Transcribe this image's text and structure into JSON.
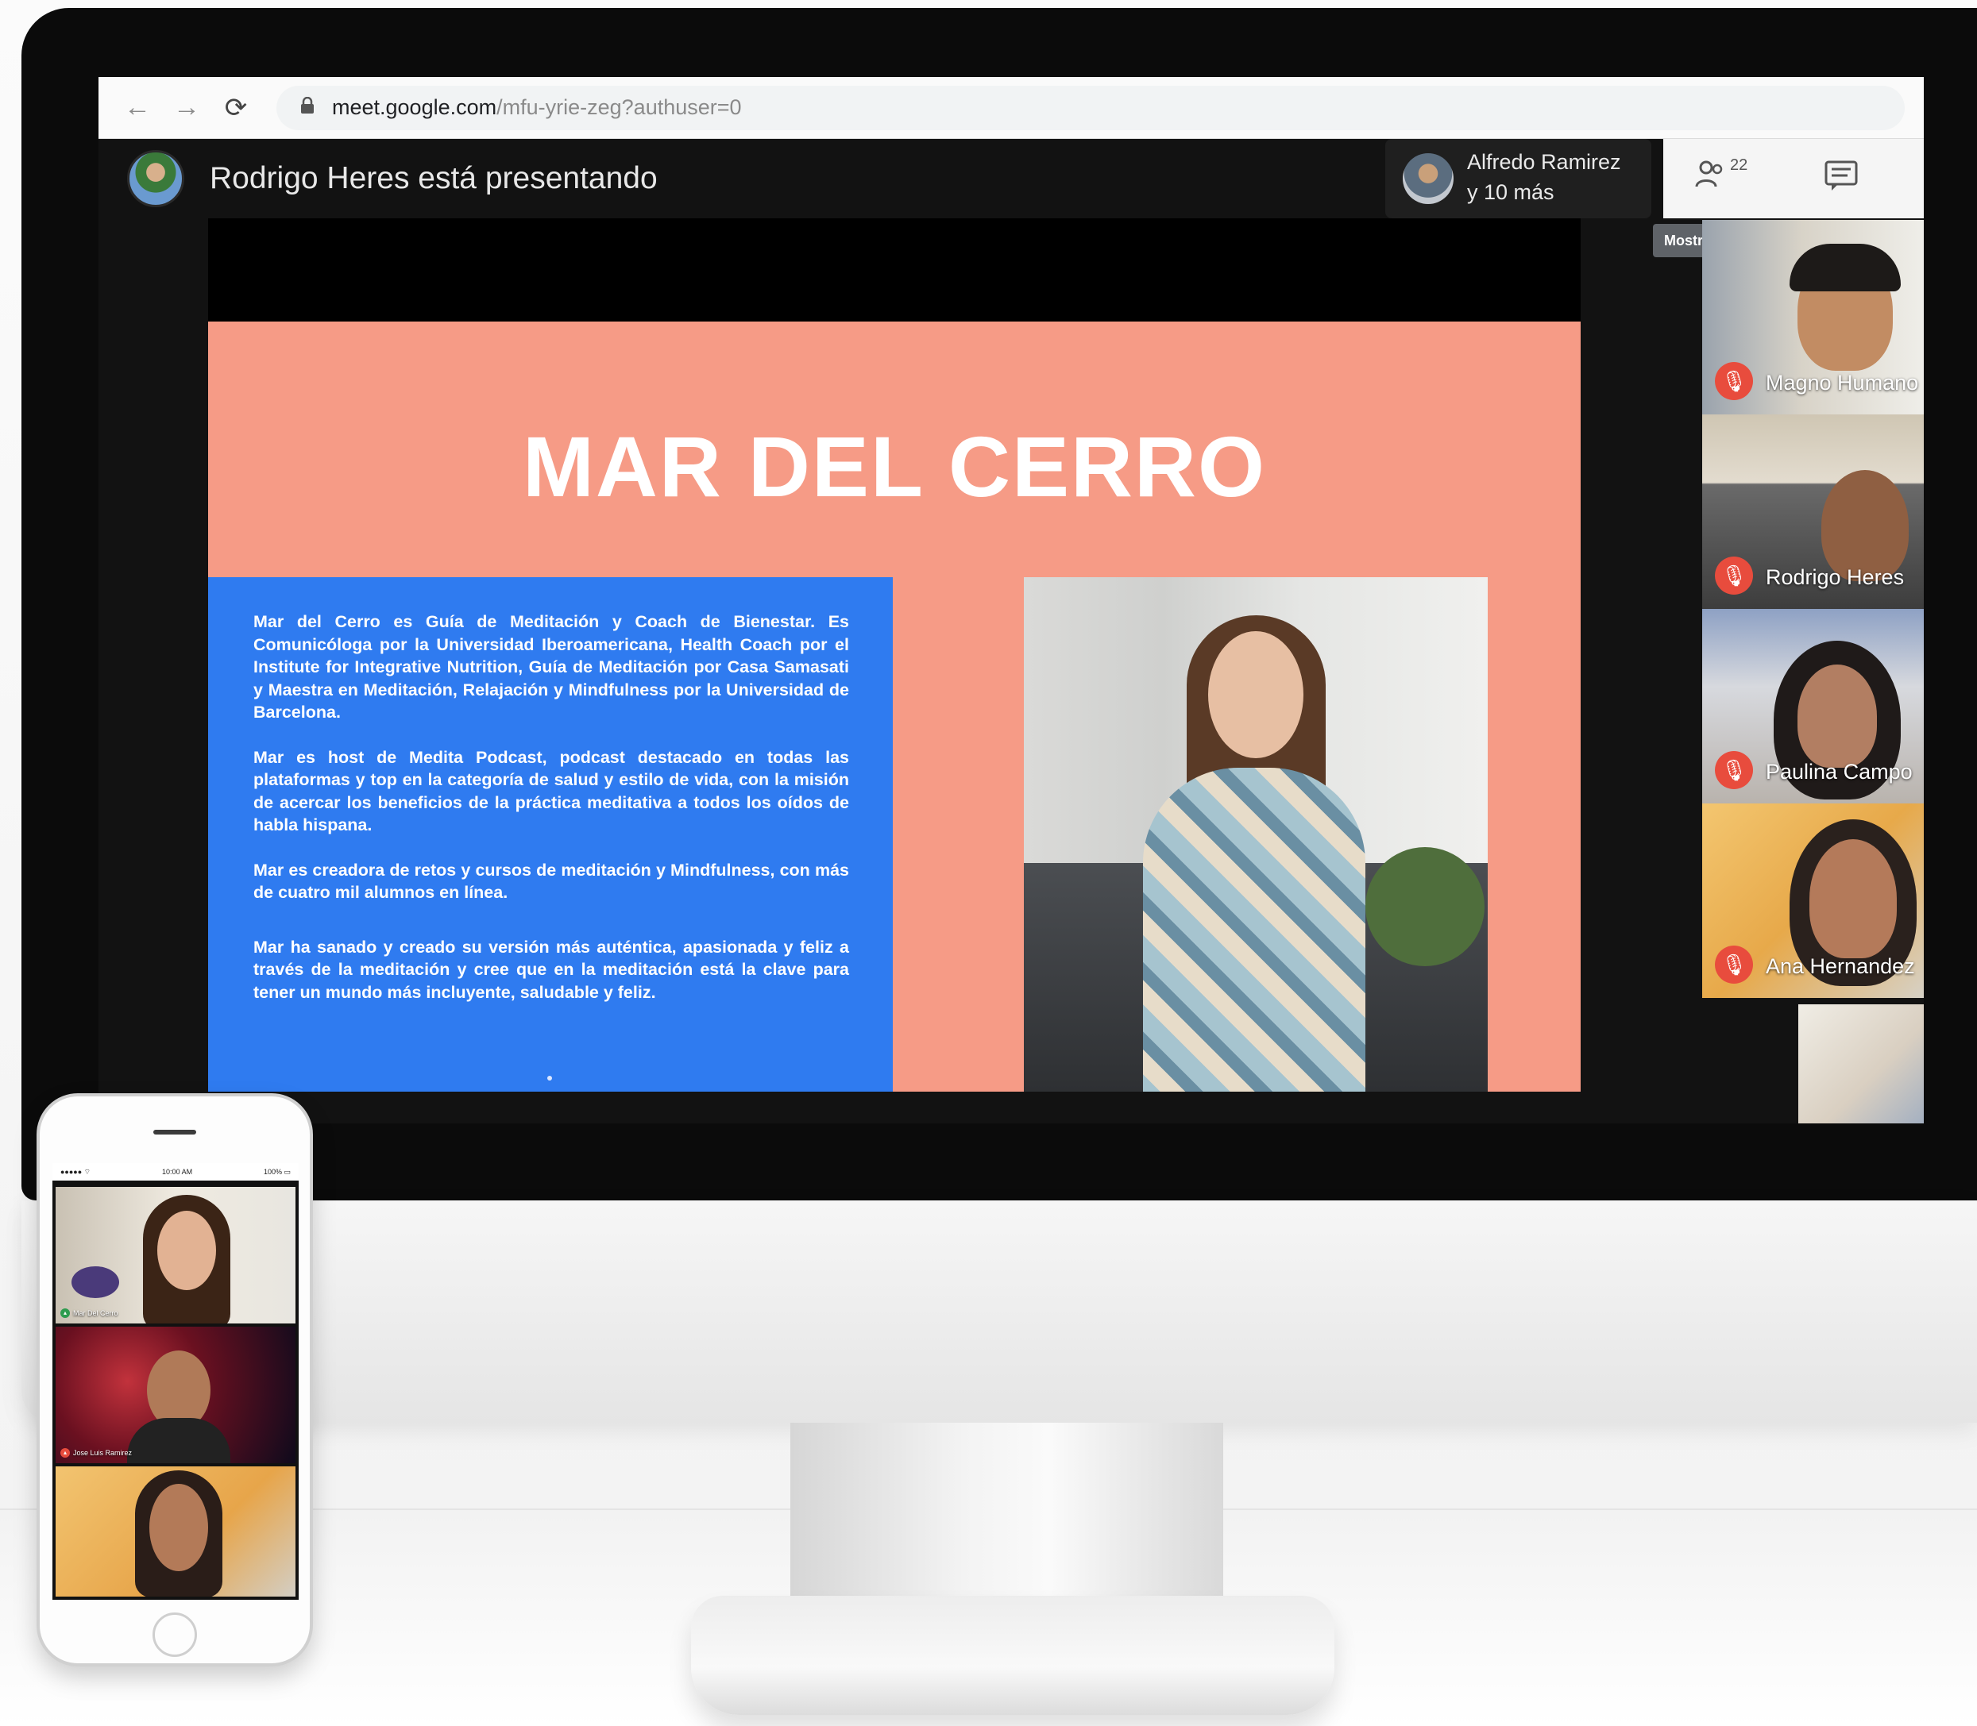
{
  "browser": {
    "back_icon": "←",
    "forward_icon": "→",
    "reload_icon": "⟳",
    "lock_icon": "🔒",
    "url_host": "meet.google.com",
    "url_path": "/mfu-yrie-zeg?authuser=0"
  },
  "meet": {
    "presenting_label": "Rodrigo Heres está presentando",
    "participants_chip": {
      "name": "Alfredo Ramirez",
      "more": "y 10 más"
    },
    "people_count": "22",
    "tooltip": "Mostrar a todos",
    "people_icon": "people-icon",
    "chat_icon": "chat-icon"
  },
  "slide": {
    "title": "MAR DEL CERRO",
    "paragraphs": [
      "Mar del Cerro es Guía de Meditación y Coach de Bienestar. Es Comunicóloga por la Universidad Iberoamericana, Health Coach por el Institute for Integrative Nutrition, Guía de Meditación por Casa Samasati y Maestra en Meditación, Relajación y Mindfulness por la Universidad de Barcelona.",
      "Mar es host de Medita Podcast, podcast destacado en todas las plataformas y top en la categoría de salud y estilo de vida, con la misión de acercar los beneficios de la práctica meditativa a todos los oídos de habla hispana.",
      "Mar es creadora de retos y cursos de meditación y Mindfulness, con más de cuatro mil alumnos en línea.",
      "Mar ha sanado y creado su versión más auténtica, apasionada y feliz a través de la meditación y cree que en la meditación está la clave para tener un mundo más incluyente, saludable y feliz."
    ]
  },
  "tiles": [
    {
      "name": "Magno Humano"
    },
    {
      "name": "Rodrigo Heres"
    },
    {
      "name": "Paulina Campo"
    },
    {
      "name": "Ana Hernandez"
    }
  ],
  "phone": {
    "status_time": "10:00 AM",
    "status_signal": "●●●●● ⌔",
    "status_battery": "100% ▭",
    "tiles": [
      {
        "name": "Mar Del Cerro"
      },
      {
        "name": "Jose Luis Ramirez"
      }
    ]
  },
  "colors": {
    "slide_bg": "#f69b86",
    "bio_box": "#2f7bf0",
    "mic_muted": "#e84c3d"
  }
}
